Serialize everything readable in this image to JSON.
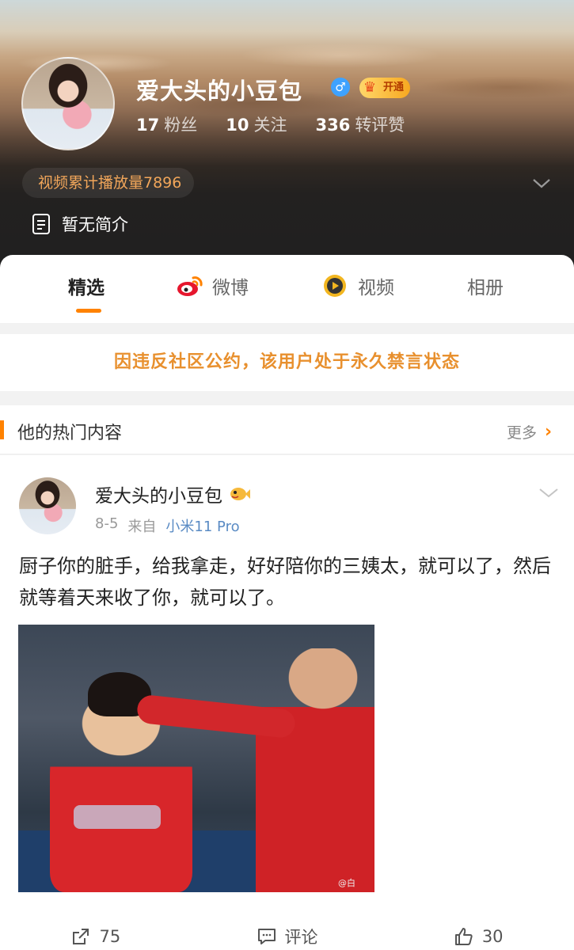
{
  "profile": {
    "username": "爱大头的小豆包",
    "gender_symbol": "♂",
    "vip_label": "开通",
    "stats": [
      {
        "num": "17",
        "label": "粉丝"
      },
      {
        "num": "10",
        "label": "关注"
      },
      {
        "num": "336",
        "label": "转评赞"
      }
    ],
    "play_count": "视频累计播放量7896",
    "bio": "暂无简介"
  },
  "tabs": [
    {
      "label": "精选"
    },
    {
      "label": "微博"
    },
    {
      "label": "视频"
    },
    {
      "label": "相册"
    }
  ],
  "ban_notice": "因违反社区公约，该用户处于永久禁言状态",
  "hot": {
    "title": "他的热门内容",
    "more": "更多"
  },
  "post": {
    "author": "爱大头的小豆包",
    "date": "8-5",
    "from": "来自",
    "source": "小米11 Pro",
    "text": "厨子你的脏手，给我拿走，好好陪你的三姨太，就可以了，然后就等着天来收了你，就可以了。",
    "watermark": "@白"
  },
  "actions": {
    "repost_count": "75",
    "comment_label": "评论",
    "like_count": "30"
  },
  "colors": {
    "accent": "#ff8200",
    "ban_text": "#e8902e",
    "play_count_text": "#f2a65a",
    "source_link": "#5a8bc4"
  }
}
